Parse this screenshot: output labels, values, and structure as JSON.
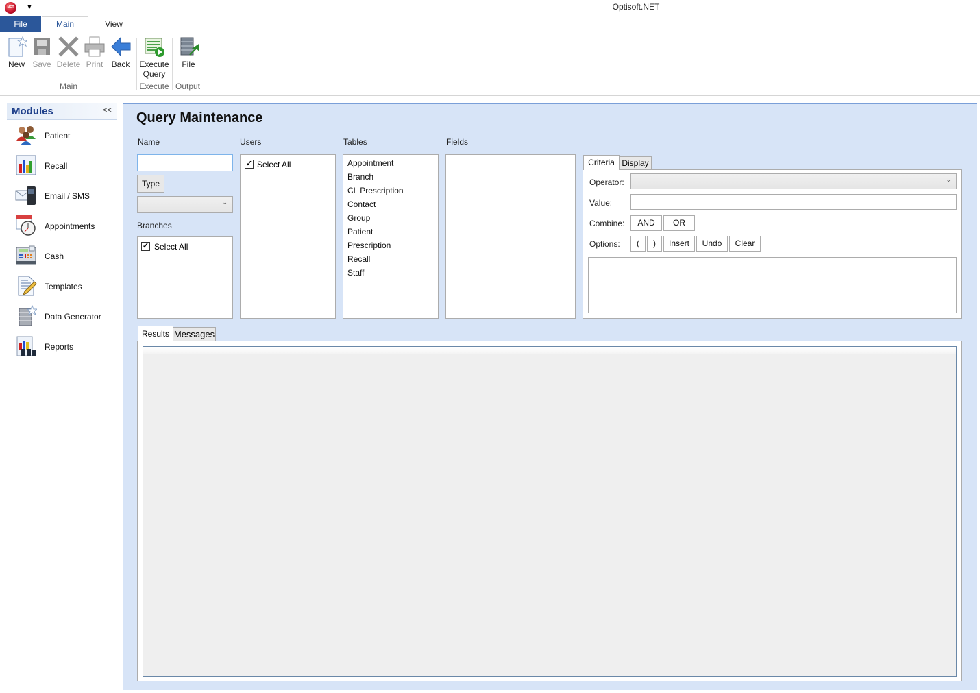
{
  "window": {
    "title": "Optisoft.NET",
    "app_icon_text": "NET"
  },
  "ribbon": {
    "tabs": [
      {
        "label": "File"
      },
      {
        "label": "Main"
      },
      {
        "label": "View"
      }
    ],
    "active_tab": "Main",
    "buttons": [
      {
        "label": "New",
        "enabled": true,
        "icon": "new-document-icon"
      },
      {
        "label": "Save",
        "enabled": false,
        "icon": "save-icon"
      },
      {
        "label": "Delete",
        "enabled": false,
        "icon": "delete-icon"
      },
      {
        "label": "Print",
        "enabled": false,
        "icon": "print-icon"
      },
      {
        "label": "Back",
        "enabled": true,
        "icon": "back-arrow-icon"
      },
      {
        "label": "Execute Query",
        "line1": "Execute",
        "line2": "Query",
        "enabled": true,
        "icon": "execute-query-icon"
      },
      {
        "label": "File",
        "enabled": true,
        "icon": "file-output-icon"
      }
    ],
    "groups": [
      {
        "label": "Main"
      },
      {
        "label": "Execute"
      },
      {
        "label": "Output"
      }
    ]
  },
  "sidebar": {
    "title": "Modules",
    "collapse_label": "<<",
    "items": [
      {
        "label": "Patient",
        "icon": "patient-icon"
      },
      {
        "label": "Recall",
        "icon": "recall-chart-icon"
      },
      {
        "label": "Email / SMS",
        "icon": "email-sms-icon"
      },
      {
        "label": "Appointments",
        "icon": "appointments-icon"
      },
      {
        "label": "Cash",
        "icon": "cash-register-icon"
      },
      {
        "label": "Templates",
        "icon": "templates-icon"
      },
      {
        "label": "Data Generator",
        "icon": "data-generator-icon"
      },
      {
        "label": "Reports",
        "icon": "reports-icon"
      }
    ]
  },
  "main": {
    "title": "Query Maintenance",
    "name": {
      "label": "Name",
      "value": ""
    },
    "type": {
      "button_label": "Type",
      "selected": ""
    },
    "branches": {
      "label": "Branches",
      "items": [
        {
          "label": "Select All",
          "checked": true
        }
      ]
    },
    "users": {
      "label": "Users",
      "items": [
        {
          "label": "Select All",
          "checked": true
        }
      ]
    },
    "tables": {
      "label": "Tables",
      "items": [
        "Appointment",
        "Branch",
        "CL Prescription",
        "Contact",
        "Group",
        "Patient",
        "Prescription",
        "Recall",
        "Staff"
      ]
    },
    "fields": {
      "label": "Fields",
      "items": []
    },
    "criteria_tabs": [
      {
        "label": "Criteria"
      },
      {
        "label": "Display"
      }
    ],
    "active_criteria_tab": "Criteria",
    "criteria": {
      "operator_label": "Operator:",
      "operator_value": "",
      "value_label": "Value:",
      "value": "",
      "combine_label": "Combine:",
      "combine_buttons": [
        "AND",
        "OR"
      ],
      "options_label": "Options:",
      "options_buttons": [
        "(",
        ")",
        "Insert",
        "Undo",
        "Clear"
      ],
      "expression": ""
    },
    "result_tabs": [
      {
        "label": "Results"
      },
      {
        "label": "Messages"
      }
    ],
    "active_result_tab": "Results"
  }
}
